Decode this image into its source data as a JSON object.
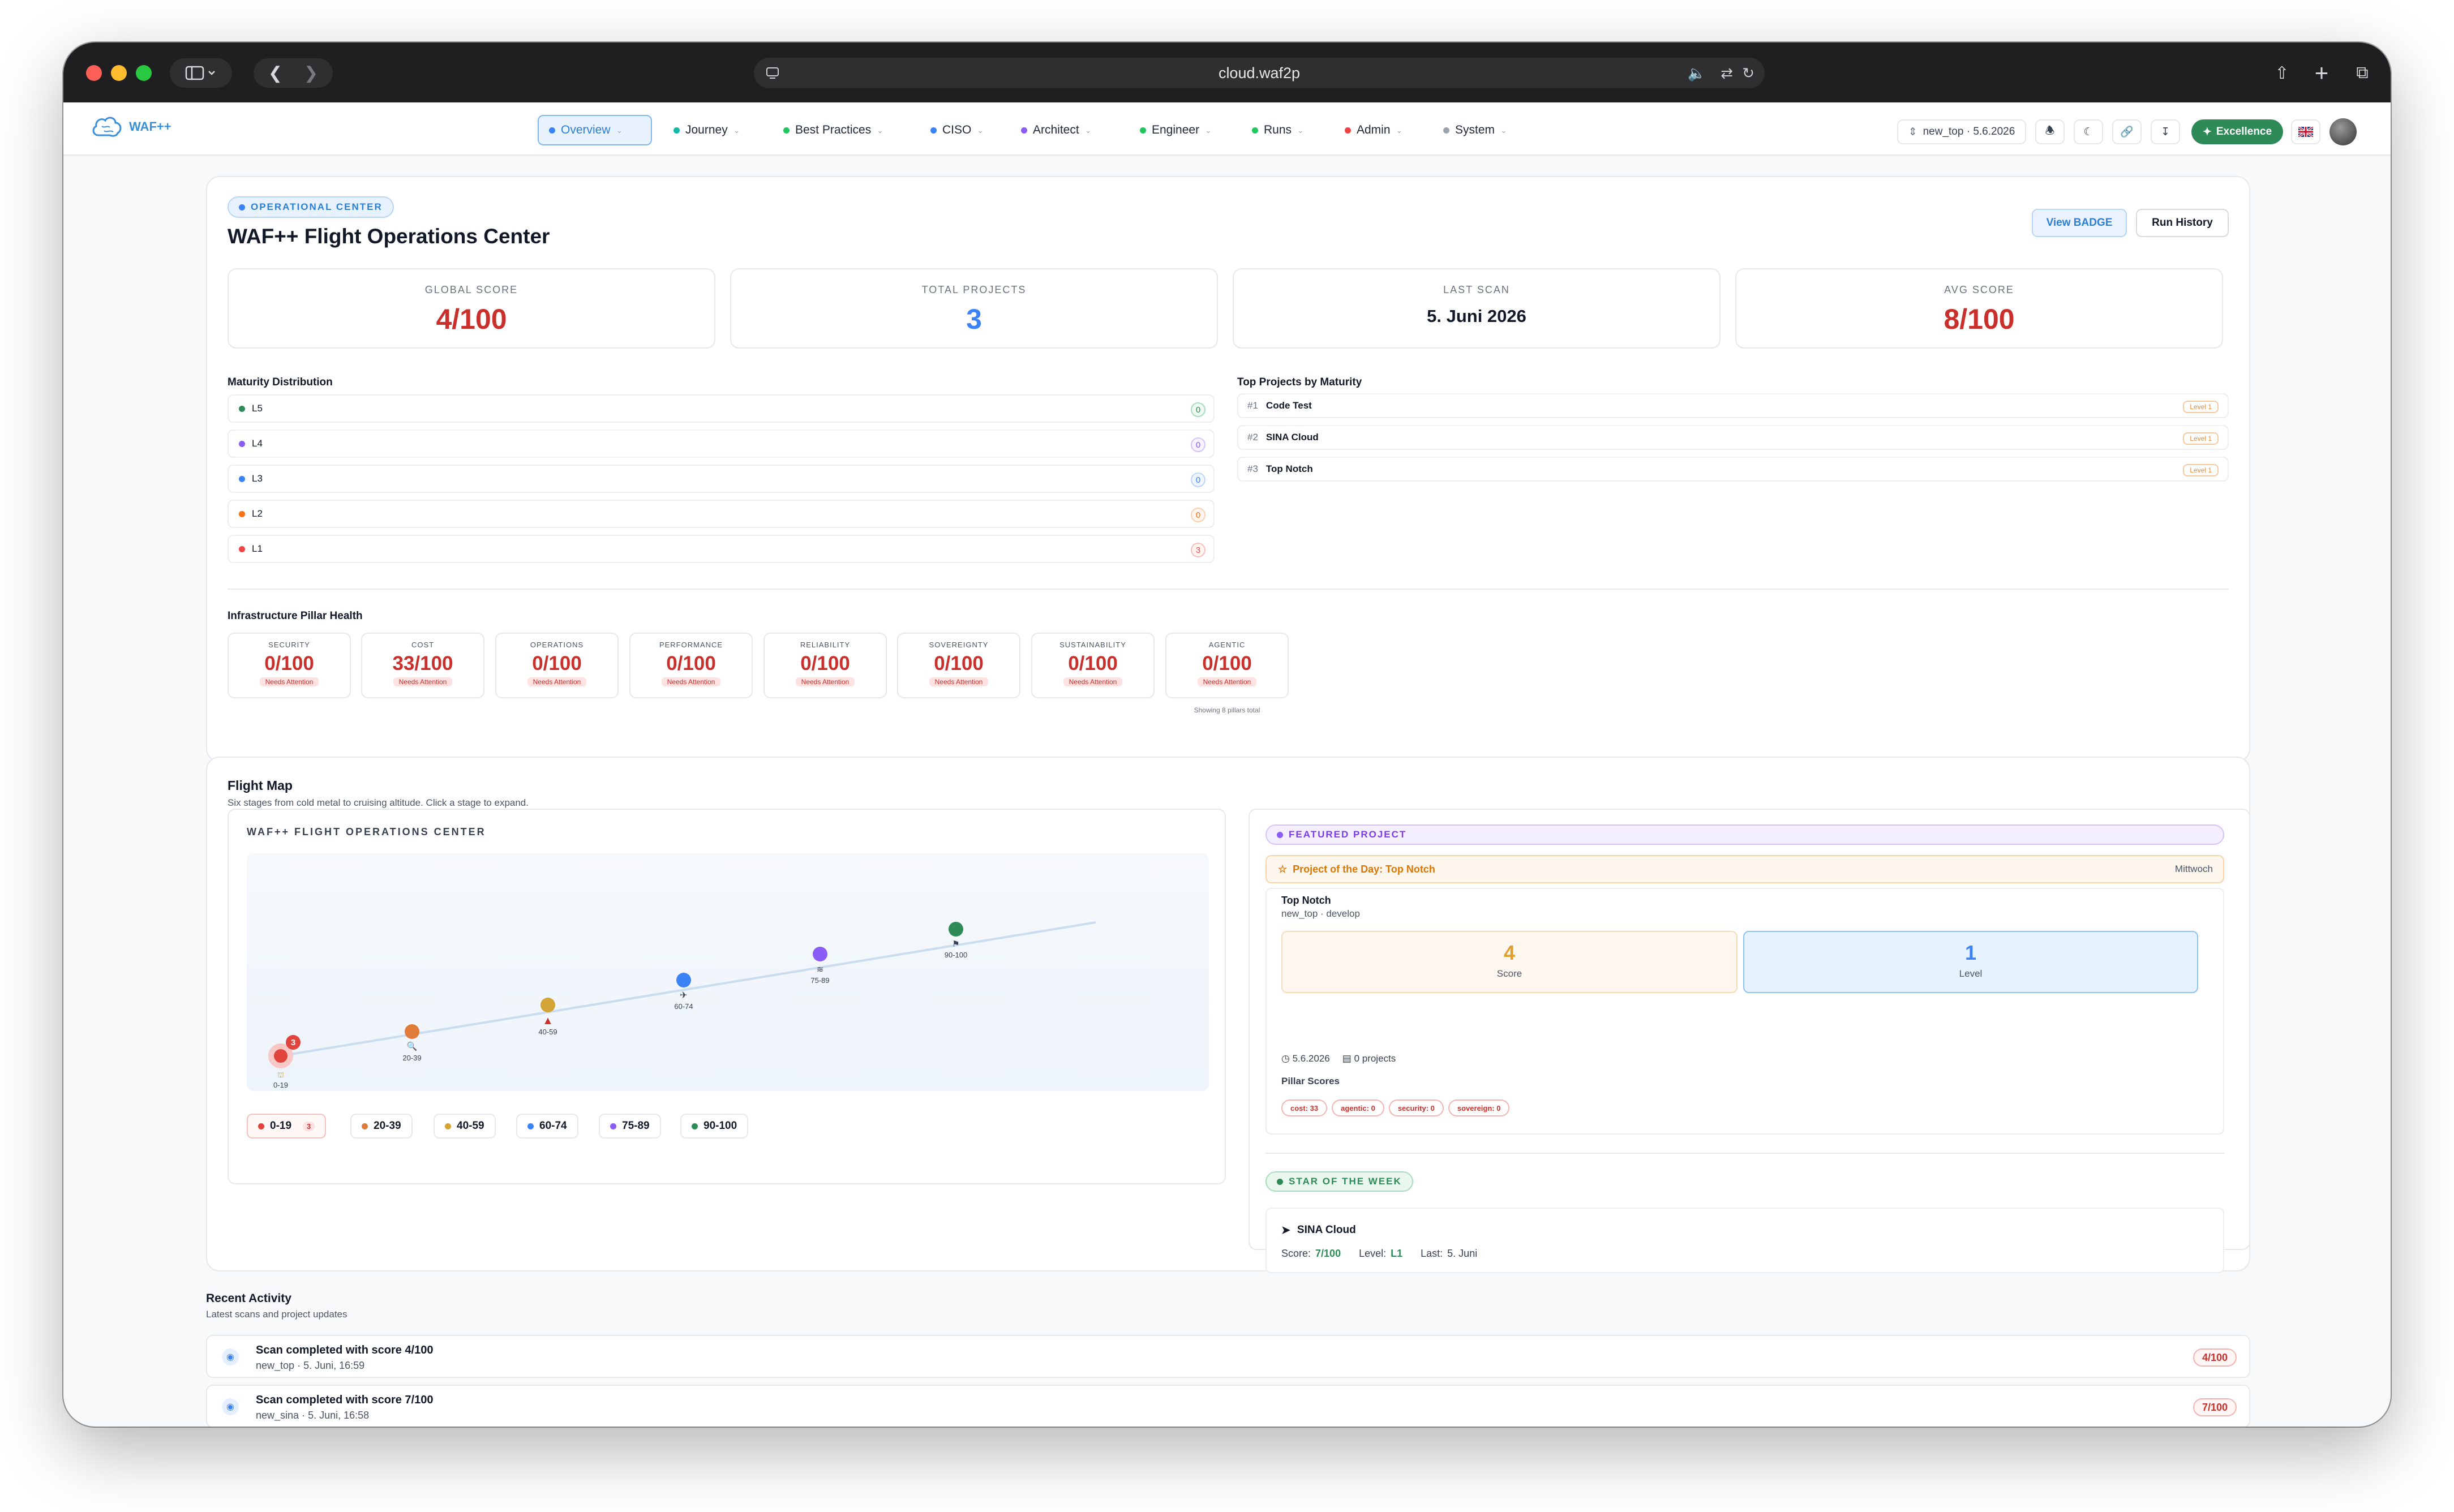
{
  "browser": {
    "url": "cloud.waf2p"
  },
  "app": {
    "logo": "WAF++"
  },
  "nav": [
    {
      "label": "Overview",
      "color": "#3b82f6"
    },
    {
      "label": "Journey",
      "color": "#14b8a6"
    },
    {
      "label": "Best Practices",
      "color": "#22c55e"
    },
    {
      "label": "CISO",
      "color": "#3b82f6"
    },
    {
      "label": "Architect",
      "color": "#8b5cf6"
    },
    {
      "label": "Engineer",
      "color": "#22c55e"
    },
    {
      "label": "Runs",
      "color": "#22c55e"
    },
    {
      "label": "Admin",
      "color": "#ef4444"
    },
    {
      "label": "System",
      "color": "#9ca3af"
    }
  ],
  "header_right": {
    "project_select": "new_top · 5.6.2026",
    "badge": "Excellence"
  },
  "ops": {
    "tag": "OPERATIONAL CENTER",
    "title": "WAF++ Flight Operations Center",
    "view_badge": "View BADGE",
    "run_history": "Run History"
  },
  "stats": [
    {
      "label": "GLOBAL SCORE",
      "value": "4/100",
      "color": "#c9302c"
    },
    {
      "label": "TOTAL PROJECTS",
      "value": "3",
      "color": "#3b82f6"
    },
    {
      "label": "LAST SCAN",
      "value": "5. Juni 2026",
      "color": "#111827"
    },
    {
      "label": "AVG SCORE",
      "value": "8/100",
      "color": "#c9302c"
    }
  ],
  "maturity": {
    "title": "Maturity Distribution",
    "rows": [
      {
        "label": "L5",
        "count": "0",
        "color": "#2e8b57"
      },
      {
        "label": "L4",
        "count": "0",
        "color": "#8b5cf6"
      },
      {
        "label": "L3",
        "count": "0",
        "color": "#3b82f6"
      },
      {
        "label": "L2",
        "count": "0",
        "color": "#f97316"
      },
      {
        "label": "L1",
        "count": "3",
        "color": "#ef4444"
      }
    ]
  },
  "top_projects": {
    "title": "Top Projects by Maturity",
    "rows": [
      {
        "rank": "#1",
        "name": "Code Test",
        "level": "Level 1"
      },
      {
        "rank": "#2",
        "name": "SINA Cloud",
        "level": "Level 1"
      },
      {
        "rank": "#3",
        "name": "Top Notch",
        "level": "Level 1"
      }
    ]
  },
  "pillars": {
    "title": "Infrastructure Pillar Health",
    "items": [
      {
        "name": "SECURITY",
        "value": "0/100",
        "status": "Needs Attention"
      },
      {
        "name": "COST",
        "value": "33/100",
        "status": "Needs Attention"
      },
      {
        "name": "OPERATIONS",
        "value": "0/100",
        "status": "Needs Attention"
      },
      {
        "name": "PERFORMANCE",
        "value": "0/100",
        "status": "Needs Attention"
      },
      {
        "name": "RELIABILITY",
        "value": "0/100",
        "status": "Needs Attention"
      },
      {
        "name": "SOVEREIGNTY",
        "value": "0/100",
        "status": "Needs Attention"
      },
      {
        "name": "SUSTAINABILITY",
        "value": "0/100",
        "status": "Needs Attention"
      },
      {
        "name": "AGENTIC",
        "value": "0/100",
        "status": "Needs Attention"
      }
    ],
    "footer": "Showing 8 pillars total"
  },
  "flight_map": {
    "title": "Flight Map",
    "subtitle": "Six stages from cold metal to cruising altitude. Click a stage to expand.",
    "panel_title": "WAF++ FLIGHT OPERATIONS CENTER",
    "stages": [
      {
        "label": "0-19",
        "color": "#e0443c",
        "count": "3"
      },
      {
        "label": "20-39",
        "color": "#e07b39",
        "count": ""
      },
      {
        "label": "40-59",
        "color": "#d4a536",
        "count": ""
      },
      {
        "label": "60-74",
        "color": "#3b82f6",
        "count": ""
      },
      {
        "label": "75-89",
        "color": "#8b5cf6",
        "count": ""
      },
      {
        "label": "90-100",
        "color": "#2e8b57",
        "count": ""
      }
    ]
  },
  "featured": {
    "tag": "FEATURED PROJECT",
    "banner": "Project of the Day: Top Notch",
    "day": "Mittwoch",
    "name": "Top Notch",
    "sub": "new_top · develop",
    "score": "4",
    "score_label": "Score",
    "level": "1",
    "level_label": "Level",
    "date": "5.6.2026",
    "projects": "0 projects",
    "pillar_title": "Pillar Scores",
    "chips": [
      "cost: 33",
      "agentic: 0",
      "security: 0",
      "sovereign: 0"
    ]
  },
  "star": {
    "tag": "STAR OF THE WEEK",
    "name": "SINA Cloud",
    "score_label": "Score:",
    "score": "7/100",
    "level_label": "Level:",
    "level": "L1",
    "last_label": "Last:",
    "last": "5. Juni"
  },
  "activity": {
    "title": "Recent Activity",
    "subtitle": "Latest scans and project updates",
    "items": [
      {
        "title": "Scan completed with score 4/100",
        "project": "new_top",
        "time": "5. Juni, 16:59",
        "badge": "4/100"
      },
      {
        "title": "Scan completed with score 7/100",
        "project": "new_sina",
        "time": "5. Juni, 16:58",
        "badge": "7/100"
      }
    ]
  }
}
